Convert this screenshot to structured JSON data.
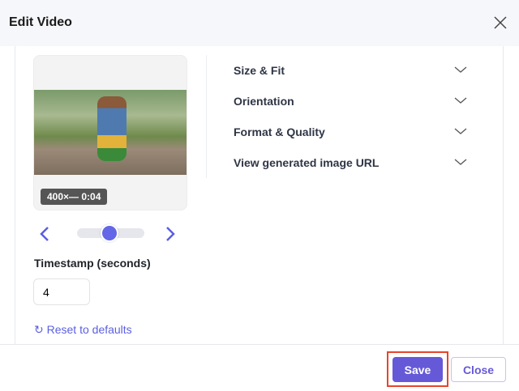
{
  "header": {
    "title": "Edit Video"
  },
  "preview": {
    "badge": "400×— 0:04",
    "slider_value_seconds": 4
  },
  "timestamp": {
    "label": "Timestamp (seconds)",
    "value": "4"
  },
  "reset_label": "Reset to defaults",
  "accordions": [
    {
      "label": "Size & Fit"
    },
    {
      "label": "Orientation"
    },
    {
      "label": "Format & Quality"
    },
    {
      "label": "View generated image URL"
    }
  ],
  "footer": {
    "save": "Save",
    "close": "Close"
  },
  "colors": {
    "accent": "#6659d8",
    "highlight": "#e8442a"
  }
}
